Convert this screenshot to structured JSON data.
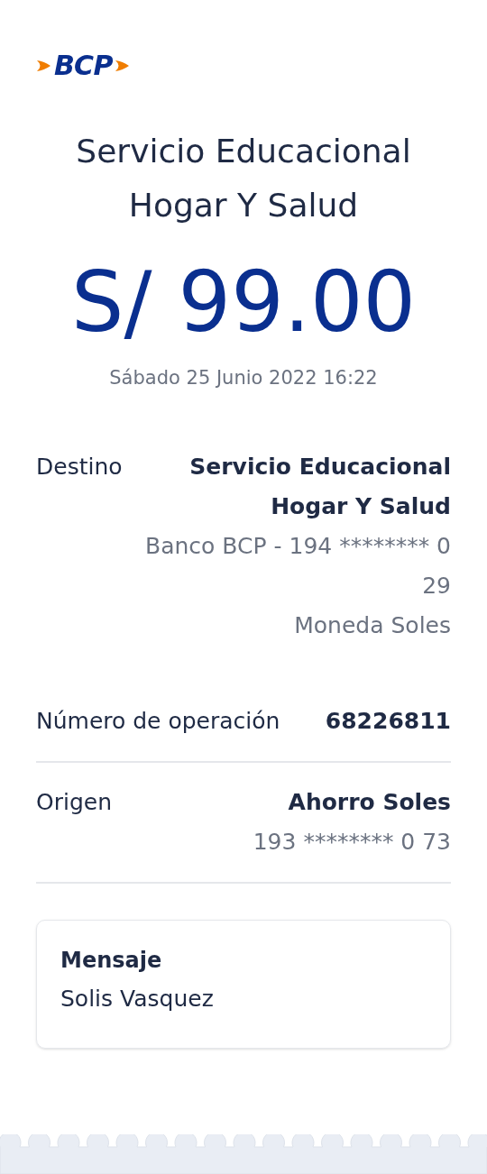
{
  "logo": {
    "text": "BCP"
  },
  "title": "Servicio Educacional Hogar Y Salud",
  "amount": "S/ 99.00",
  "date": "Sábado 25 Junio 2022 16:22",
  "details": [
    {
      "label": "Destino",
      "lines": [
        {
          "text": "Servicio Educacional Hogar Y Salud",
          "kind": "bold"
        },
        {
          "text": "Banco BCP - 194 ******** 0 29",
          "kind": "muted"
        },
        {
          "text": "Moneda Soles",
          "kind": "muted"
        }
      ]
    },
    {
      "label": "Número de operación",
      "lines": [
        {
          "text": "68226811",
          "kind": "bold"
        }
      ]
    },
    {
      "label": "Origen",
      "lines": [
        {
          "text": "Ahorro Soles",
          "kind": "bold"
        },
        {
          "text": "193 ******** 0 73",
          "kind": "muted"
        }
      ]
    }
  ],
  "message": {
    "heading": "Mensaje",
    "text": "Solis Vasquez"
  }
}
